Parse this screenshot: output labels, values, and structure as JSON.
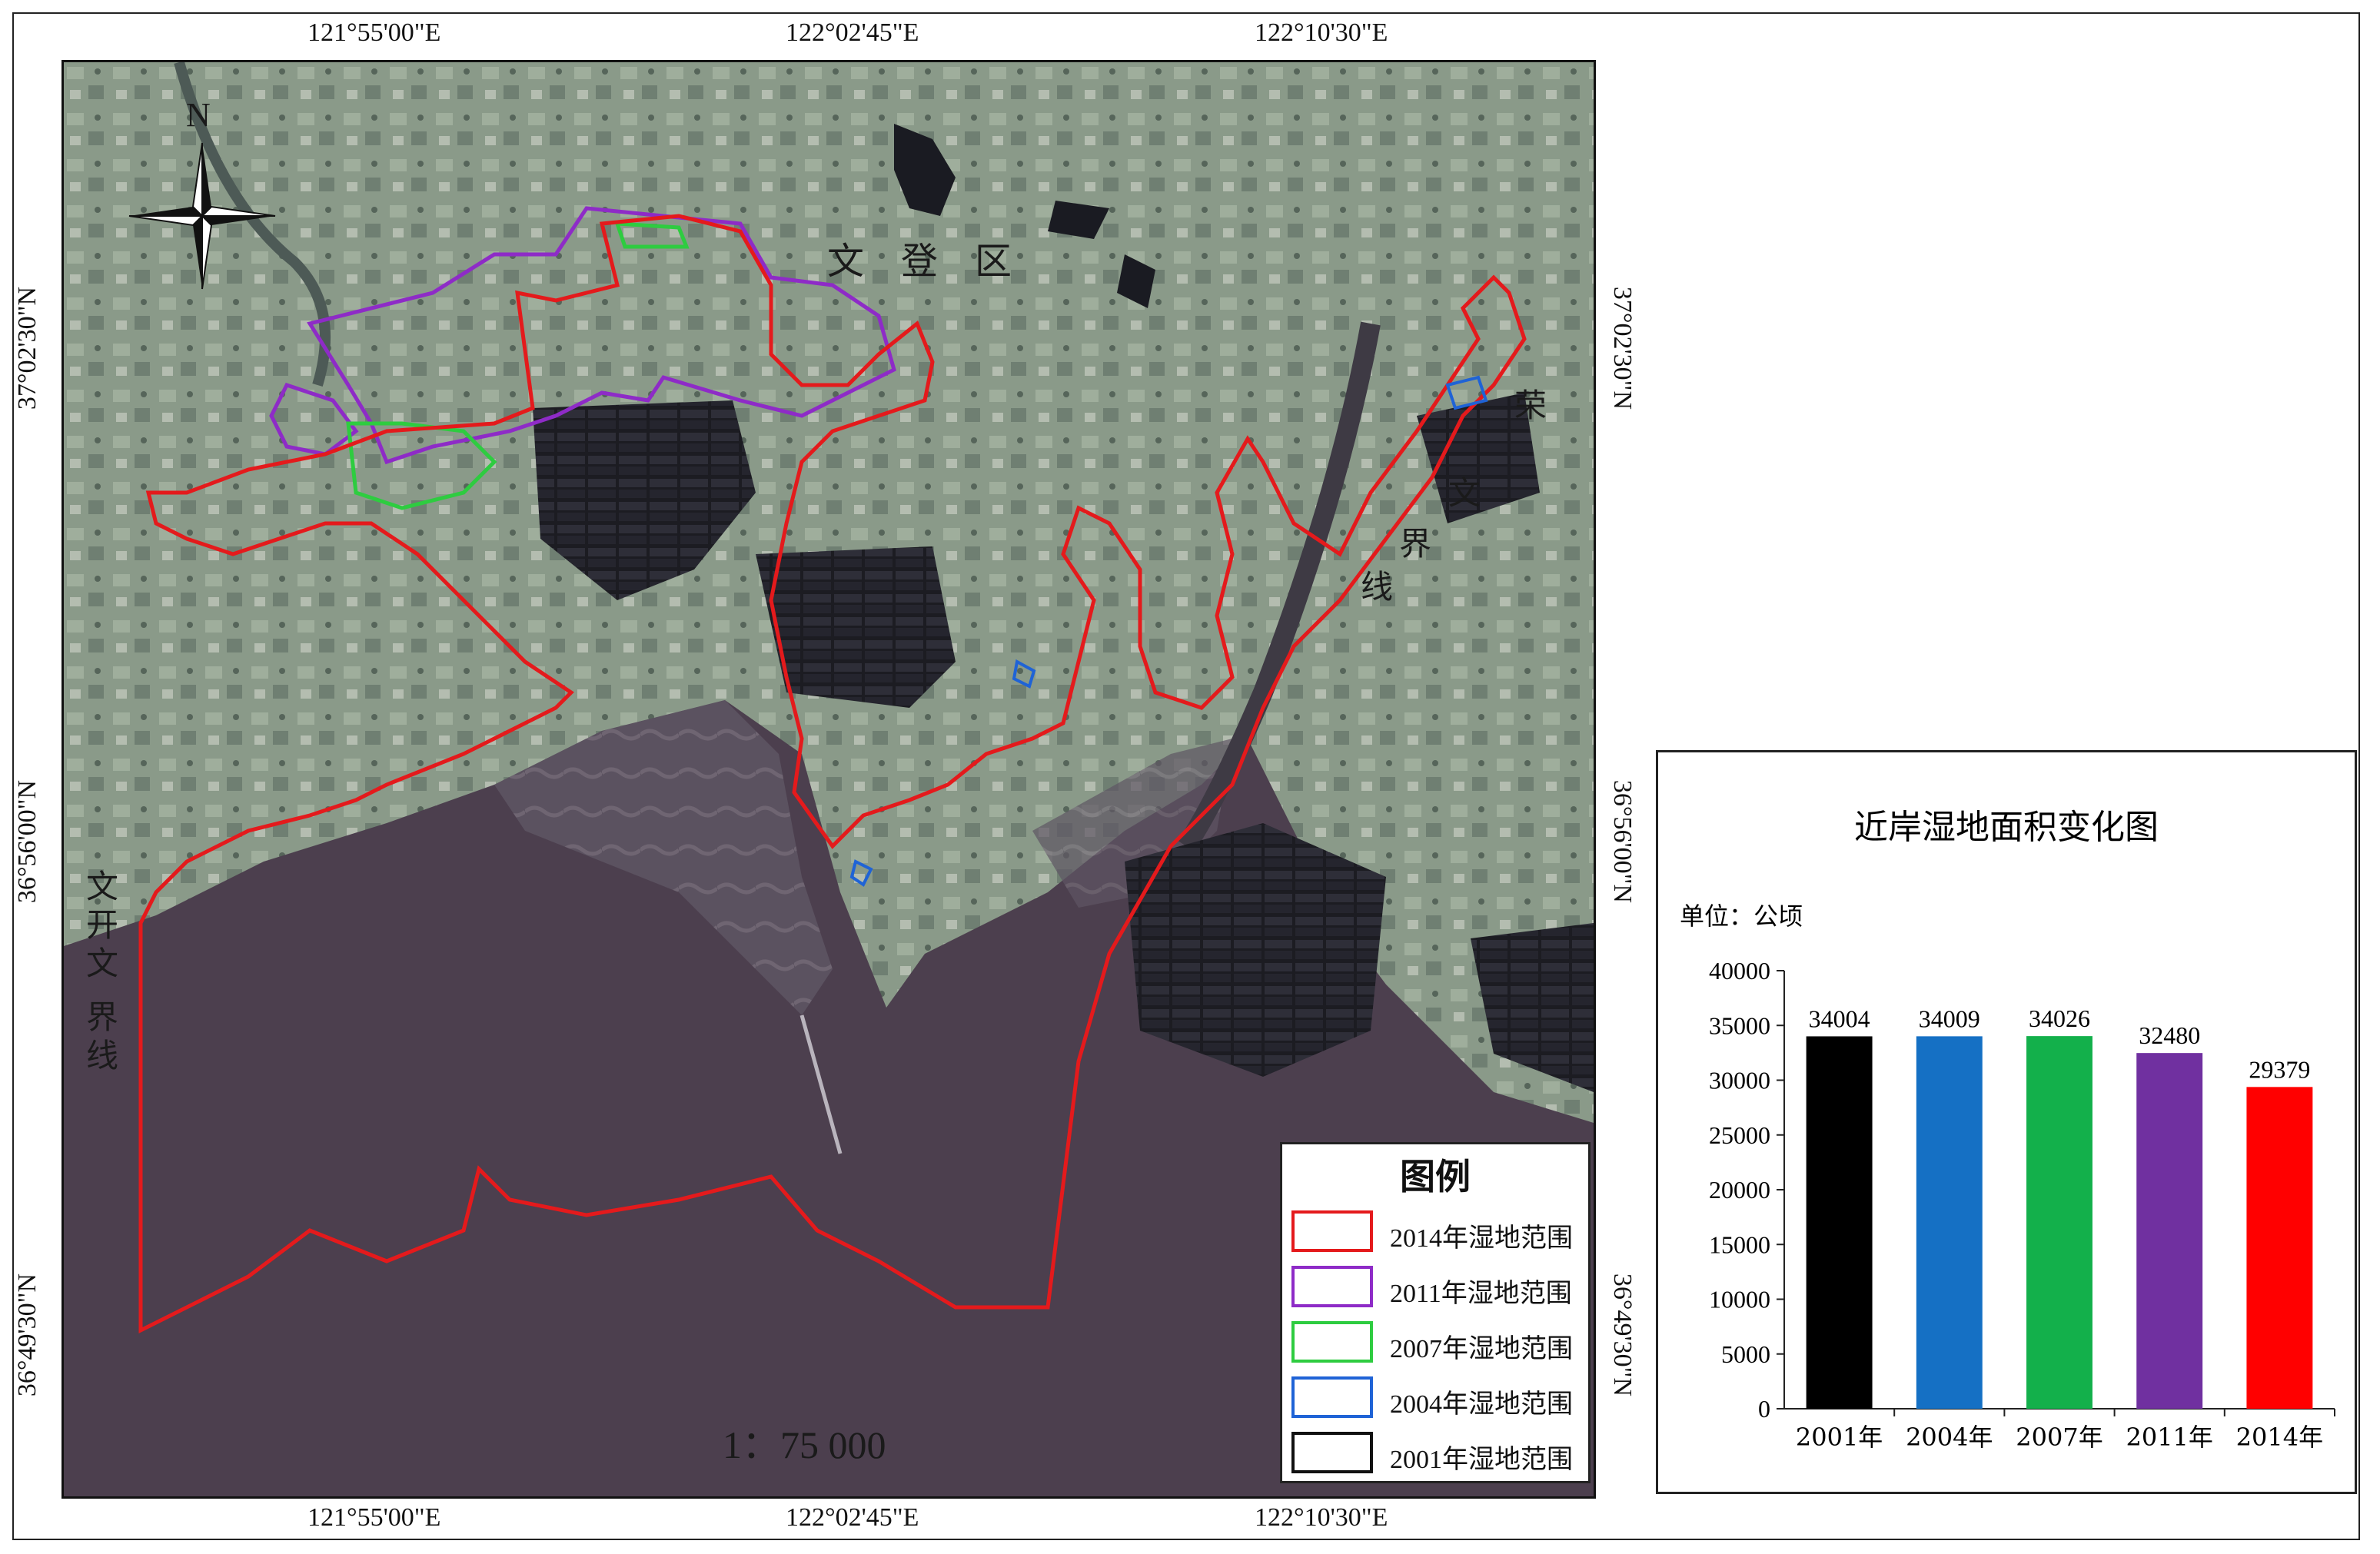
{
  "map": {
    "scale_text": "1：75 000",
    "north_label": "N",
    "region_labels": {
      "wendeng": "文　登　区",
      "border_left": [
        "文",
        "开",
        "文",
        "界",
        "线"
      ],
      "border_right": [
        "荣",
        "文",
        "界",
        "线"
      ]
    },
    "coords": {
      "top_x": [
        "121°55'00\"E",
        "122°02'45\"E",
        "122°10'30\"E"
      ],
      "bottom_x": [
        "121°55'00\"E",
        "122°02'45\"E",
        "122°10'30\"E"
      ],
      "left_y": [
        "37°02'30\"N",
        "36°56'00\"N",
        "36°49'30\"N"
      ],
      "right_y": [
        "37°02'30\"N",
        "36°56'00\"N",
        "36°49'30\"N"
      ]
    },
    "colors": {
      "land": "#7f8f80",
      "sea": "#4a3d4c",
      "wetland_2014": "#e41a1c",
      "wetland_2011": "#8e2bc7",
      "wetland_2007": "#2ecc40",
      "wetland_2004": "#1f63d6",
      "wetland_2001": "#111111"
    }
  },
  "legend": {
    "title": "图例",
    "items": [
      {
        "label": "2014年湿地范围",
        "color": "#e41a1c"
      },
      {
        "label": "2011年湿地范围",
        "color": "#8e2bc7"
      },
      {
        "label": "2007年湿地范围",
        "color": "#2ecc40"
      },
      {
        "label": "2004年湿地范围",
        "color": "#1f63d6"
      },
      {
        "label": "2001年湿地范围",
        "color": "#111111"
      }
    ]
  },
  "chart_data": {
    "type": "bar",
    "title": "近岸湿地面积变化图",
    "unit_label": "单位：公顷",
    "categories": [
      "2001年",
      "2004年",
      "2007年",
      "2011年",
      "2014年"
    ],
    "values": [
      34004,
      34009,
      34026,
      32480,
      29379
    ],
    "colors": [
      "#000000",
      "#1570c4",
      "#13b04b",
      "#7030a0",
      "#ff0000"
    ],
    "ylim": [
      0,
      40000
    ],
    "yticks": [
      0,
      5000,
      10000,
      15000,
      20000,
      25000,
      30000,
      35000,
      40000
    ],
    "grid": false
  }
}
